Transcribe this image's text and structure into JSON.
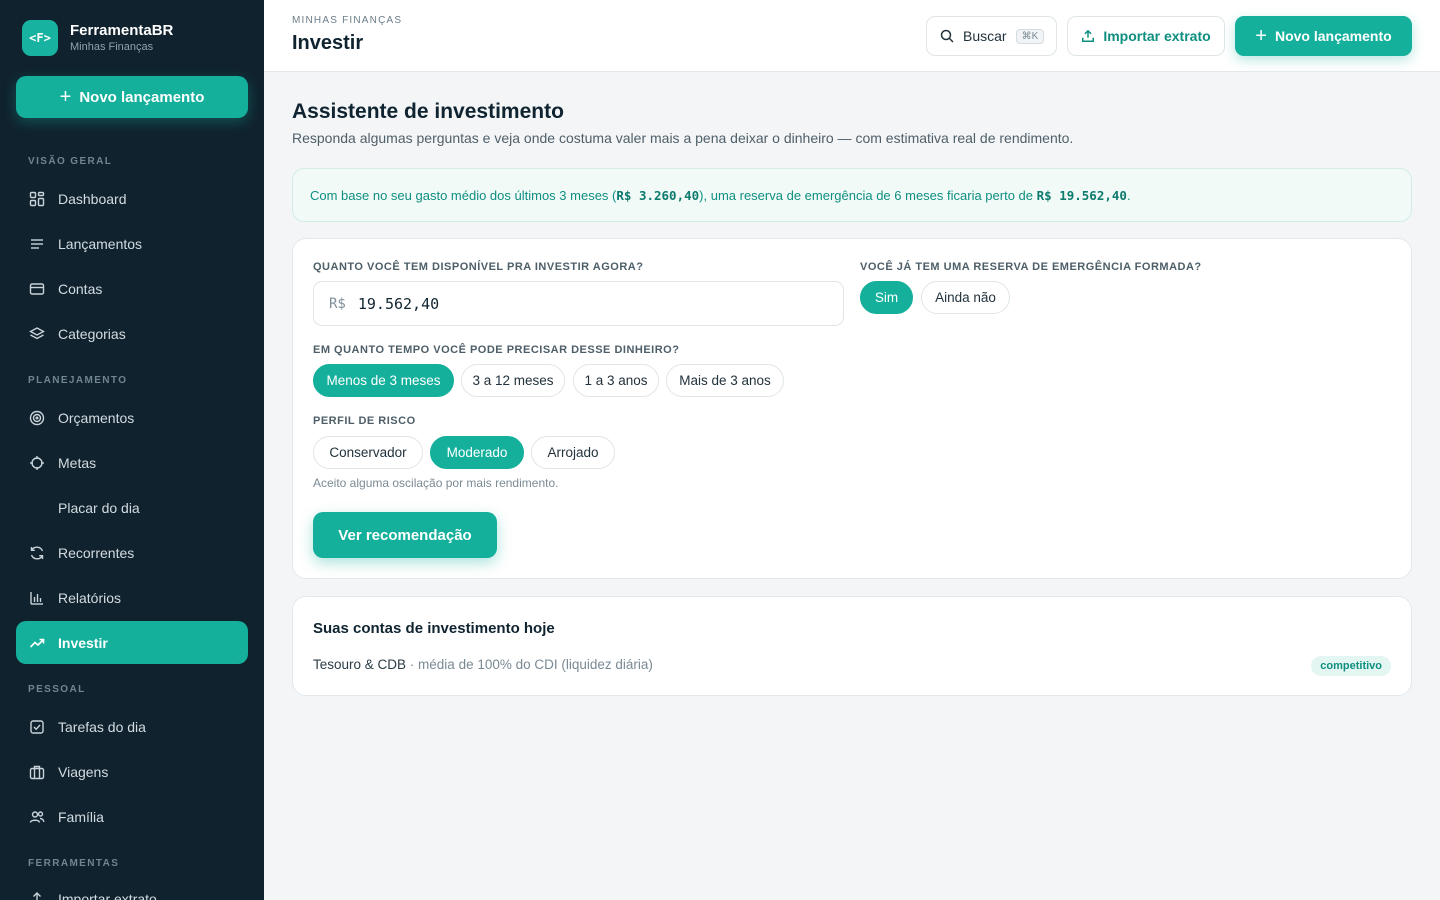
{
  "brand": {
    "logo": "<F>",
    "name": "FerramentaBR",
    "subtitle": "Minhas Finanças"
  },
  "sidebar": {
    "new_entry_label": "Novo lançamento",
    "sections": {
      "overview": "VISÃO GERAL",
      "planning": "PLANEJAMENTO",
      "personal": "PESSOAL",
      "tools": "FERRAMENTAS"
    },
    "items": [
      {
        "label": "Dashboard",
        "icon": "dashboard-grid-icon"
      },
      {
        "label": "Lançamentos",
        "icon": "list-icon"
      },
      {
        "label": "Contas",
        "icon": "card-icon"
      },
      {
        "label": "Categorias",
        "icon": "layers-icon"
      },
      {
        "label": "Orçamentos",
        "icon": "target-icon"
      },
      {
        "label": "Metas",
        "icon": "crosshair-icon"
      },
      {
        "label": "Placar do dia",
        "icon": ""
      },
      {
        "label": "Recorrentes",
        "icon": "refresh-icon"
      },
      {
        "label": "Relatórios",
        "icon": "bar-chart-icon"
      },
      {
        "label": "Investir",
        "icon": "trend-up-icon",
        "active": true
      },
      {
        "label": "Tarefas do dia",
        "icon": "checkbox-icon"
      },
      {
        "label": "Viagens",
        "icon": "suitcase-icon"
      },
      {
        "label": "Família",
        "icon": "users-icon"
      },
      {
        "label": "Importar extrato",
        "icon": "upload-icon"
      }
    ]
  },
  "header": {
    "breadcrumb": "MINHAS FINANÇAS",
    "title": "Investir",
    "search_label": "Buscar",
    "search_shortcut": "⌘K",
    "import_label": "Importar extrato",
    "new_entry_label": "Novo lançamento"
  },
  "main": {
    "title": "Assistente de investimento",
    "subtitle": "Responda algumas perguntas e veja onde costuma valer mais a pena deixar o dinheiro — com estimativa real de rendimento.",
    "info": {
      "part1": "Com base no seu gasto médio dos últimos 3 meses (",
      "avg_spend": "R$ 3.260,40",
      "part2": "), uma reserva de emergência de 6 meses ficaria perto de ",
      "reserve": "R$ 19.562,40",
      "part3": "."
    },
    "form": {
      "amount_question": "QUANTO VOCÊ TEM DISPONÍVEL PRA INVESTIR AGORA?",
      "currency": "R$",
      "amount_value": "19.562,40",
      "reserve_question": "VOCÊ JÁ TEM UMA RESERVA DE EMERGÊNCIA FORMADA?",
      "reserve_options": [
        "Sim",
        "Ainda não"
      ],
      "reserve_selected": "Sim",
      "horizon_question": "EM QUANTO TEMPO VOCÊ PODE PRECISAR DESSE DINHEIRO?",
      "horizon_options": [
        "Menos de 3 meses",
        "3 a 12 meses",
        "1 a 3 anos",
        "Mais de 3 anos"
      ],
      "horizon_selected": "Menos de 3 meses",
      "risk_question": "PERFIL DE RISCO",
      "risk_options": [
        "Conservador",
        "Moderado",
        "Arrojado"
      ],
      "risk_selected": "Moderado",
      "risk_hint": "Aceito alguma oscilação por mais rendimento.",
      "submit_label": "Ver recomendação"
    },
    "accounts": {
      "title": "Suas contas de investimento hoje",
      "rows": [
        {
          "name": "Tesouro & CDB",
          "detail": " · média de 100% do CDI (liquidez diária)",
          "badge": "competitivo"
        }
      ]
    }
  },
  "colors": {
    "accent": "#14b09c",
    "sidebar_bg": "#10222e",
    "page_bg": "#f3f5f7"
  }
}
